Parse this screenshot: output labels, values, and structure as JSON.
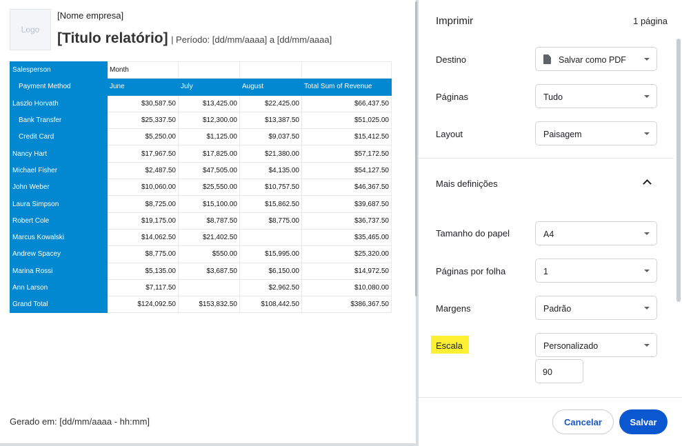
{
  "preview": {
    "logo": "Logo",
    "company": "[Nome empresa]",
    "title": "[Titulo relatório]",
    "period": "| Período: [dd/mm/aaaa] a [dd/mm/aaaa]",
    "generated": "Gerado em: [dd/mm/aaaa - hh:mm]",
    "table": {
      "salesperson_label": "Salesperson",
      "month_label": "Month",
      "payment_method_label": "Payment Method",
      "columns": [
        "June",
        "July",
        "August",
        "Total Sum of Revenue"
      ],
      "rows": [
        {
          "label": "Laszlo Horvath",
          "indent": false,
          "values": [
            "$30,587.50",
            "$13,425.00",
            "$22,425.00",
            "$66,437.50"
          ]
        },
        {
          "label": "Bank Transfer",
          "indent": true,
          "values": [
            "$25,337.50",
            "$12,300.00",
            "$13,387.50",
            "$51,025.00"
          ]
        },
        {
          "label": "Credit Card",
          "indent": true,
          "values": [
            "$5,250.00",
            "$1,125.00",
            "$9,037.50",
            "$15,412.50"
          ]
        },
        {
          "label": "Nancy Hart",
          "indent": false,
          "values": [
            "$17,967.50",
            "$17,825.00",
            "$21,380.00",
            "$57,172.50"
          ]
        },
        {
          "label": "Michael Fisher",
          "indent": false,
          "values": [
            "$2,487.50",
            "$47,505.00",
            "$4,135.00",
            "$54,127.50"
          ]
        },
        {
          "label": "John Weber",
          "indent": false,
          "values": [
            "$10,060.00",
            "$25,550.00",
            "$10,757.50",
            "$46,367.50"
          ]
        },
        {
          "label": "Laura Simpson",
          "indent": false,
          "values": [
            "$8,725.00",
            "$15,100.00",
            "$15,862.50",
            "$39,687.50"
          ]
        },
        {
          "label": "Robert Cole",
          "indent": false,
          "values": [
            "$19,175.00",
            "$8,787.50",
            "$8,775.00",
            "$36,737.50"
          ]
        },
        {
          "label": "Marcus Kowalski",
          "indent": false,
          "values": [
            "$14,062.50",
            "$21,402.50",
            "",
            "$35,465.00"
          ]
        },
        {
          "label": "Andrew Spacey",
          "indent": false,
          "values": [
            "$8,775.00",
            "$550.00",
            "$15,995.00",
            "$25,320.00"
          ]
        },
        {
          "label": "Marina Rossi",
          "indent": false,
          "values": [
            "$5,135.00",
            "$3,687.50",
            "$6,150.00",
            "$14,972.50"
          ]
        },
        {
          "label": "Ann Larson",
          "indent": false,
          "values": [
            "$7,117.50",
            "",
            "$2,962.50",
            "$10,080.00"
          ]
        },
        {
          "label": "Grand Total",
          "indent": false,
          "values": [
            "$124,092.50",
            "$153,832.50",
            "$108,442.50",
            "$386,367.50"
          ]
        }
      ]
    }
  },
  "settings": {
    "title": "Imprimir",
    "page_count": "1 página",
    "destination": {
      "label": "Destino",
      "value": "Salvar como PDF",
      "icon": "document-icon"
    },
    "pages": {
      "label": "Páginas",
      "value": "Tudo"
    },
    "layout": {
      "label": "Layout",
      "value": "Paisagem"
    },
    "more_settings": {
      "label": "Mais definições",
      "icon": "chevron-up-icon"
    },
    "paper_size": {
      "label": "Tamanho do papel",
      "value": "A4"
    },
    "pages_per_sheet": {
      "label": "Páginas por folha",
      "value": "1"
    },
    "margins": {
      "label": "Margens",
      "value": "Padrão"
    },
    "scale": {
      "label": "Escala",
      "value": "Personalizado",
      "custom_value": "90",
      "highlight_color": "#fdf032"
    },
    "cancel_label": "Cancelar",
    "save_label": "Salvar"
  },
  "colors": {
    "table_accent": "#0288d1",
    "primary_button": "#0b57d0",
    "secondary_button_text": "#1a56c2"
  }
}
